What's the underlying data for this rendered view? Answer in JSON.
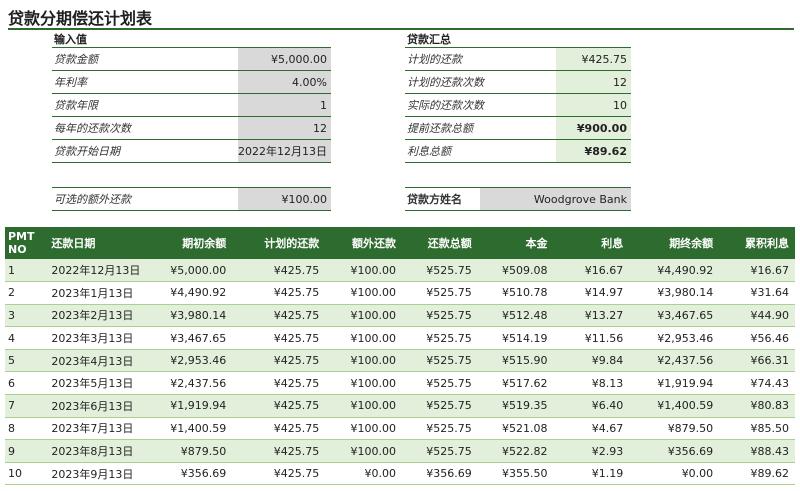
{
  "title": "贷款分期偿还计划表",
  "input": {
    "heading": "输入值",
    "rows": [
      {
        "label": "贷款金额",
        "value": "¥5,000.00"
      },
      {
        "label": "年利率",
        "value": "4.00%"
      },
      {
        "label": "贷款年限",
        "value": "1"
      },
      {
        "label": "每年的还款次数",
        "value": "12"
      },
      {
        "label": "贷款开始日期",
        "value": "2022年12月13日"
      }
    ],
    "extra_label": "可选的额外还款",
    "extra_value": "¥100.00"
  },
  "summary": {
    "heading": "贷款汇总",
    "rows": [
      {
        "label": "计划的还款",
        "value": "¥425.75"
      },
      {
        "label": "计划的还款次数",
        "value": "12"
      },
      {
        "label": "实际的还款次数",
        "value": "10"
      },
      {
        "label": "提前还款总额",
        "value": "¥900.00"
      },
      {
        "label": "利息总额",
        "value": "¥89.62"
      }
    ],
    "lender_label": "贷款方姓名",
    "lender_value": "Woodgrove Bank"
  },
  "table": {
    "headers": [
      "PMT NO",
      "还款日期",
      "期初余额",
      "计划的还款",
      "额外还款",
      "还款总额",
      "本金",
      "利息",
      "期终余额",
      "累积利息"
    ],
    "rows": [
      [
        "1",
        "2022年12月13日",
        "¥5,000.00",
        "¥425.75",
        "¥100.00",
        "¥525.75",
        "¥509.08",
        "¥16.67",
        "¥4,490.92",
        "¥16.67"
      ],
      [
        "2",
        "2023年1月13日",
        "¥4,490.92",
        "¥425.75",
        "¥100.00",
        "¥525.75",
        "¥510.78",
        "¥14.97",
        "¥3,980.14",
        "¥31.64"
      ],
      [
        "3",
        "2023年2月13日",
        "¥3,980.14",
        "¥425.75",
        "¥100.00",
        "¥525.75",
        "¥512.48",
        "¥13.27",
        "¥3,467.65",
        "¥44.90"
      ],
      [
        "4",
        "2023年3月13日",
        "¥3,467.65",
        "¥425.75",
        "¥100.00",
        "¥525.75",
        "¥514.19",
        "¥11.56",
        "¥2,953.46",
        "¥56.46"
      ],
      [
        "5",
        "2023年4月13日",
        "¥2,953.46",
        "¥425.75",
        "¥100.00",
        "¥525.75",
        "¥515.90",
        "¥9.84",
        "¥2,437.56",
        "¥66.31"
      ],
      [
        "6",
        "2023年5月13日",
        "¥2,437.56",
        "¥425.75",
        "¥100.00",
        "¥525.75",
        "¥517.62",
        "¥8.13",
        "¥1,919.94",
        "¥74.43"
      ],
      [
        "7",
        "2023年6月13日",
        "¥1,919.94",
        "¥425.75",
        "¥100.00",
        "¥525.75",
        "¥519.35",
        "¥6.40",
        "¥1,400.59",
        "¥80.83"
      ],
      [
        "8",
        "2023年7月13日",
        "¥1,400.59",
        "¥425.75",
        "¥100.00",
        "¥525.75",
        "¥521.08",
        "¥4.67",
        "¥879.50",
        "¥85.50"
      ],
      [
        "9",
        "2023年8月13日",
        "¥879.50",
        "¥425.75",
        "¥100.00",
        "¥525.75",
        "¥522.82",
        "¥2.93",
        "¥356.69",
        "¥88.43"
      ],
      [
        "10",
        "2023年9月13日",
        "¥356.69",
        "¥425.75",
        "¥0.00",
        "¥356.69",
        "¥355.50",
        "¥1.19",
        "¥0.00",
        "¥89.62"
      ]
    ]
  },
  "colors": {
    "header_green": "#2e6b2e",
    "band_green": "#e2efda",
    "input_gray": "#d9d9d9"
  }
}
